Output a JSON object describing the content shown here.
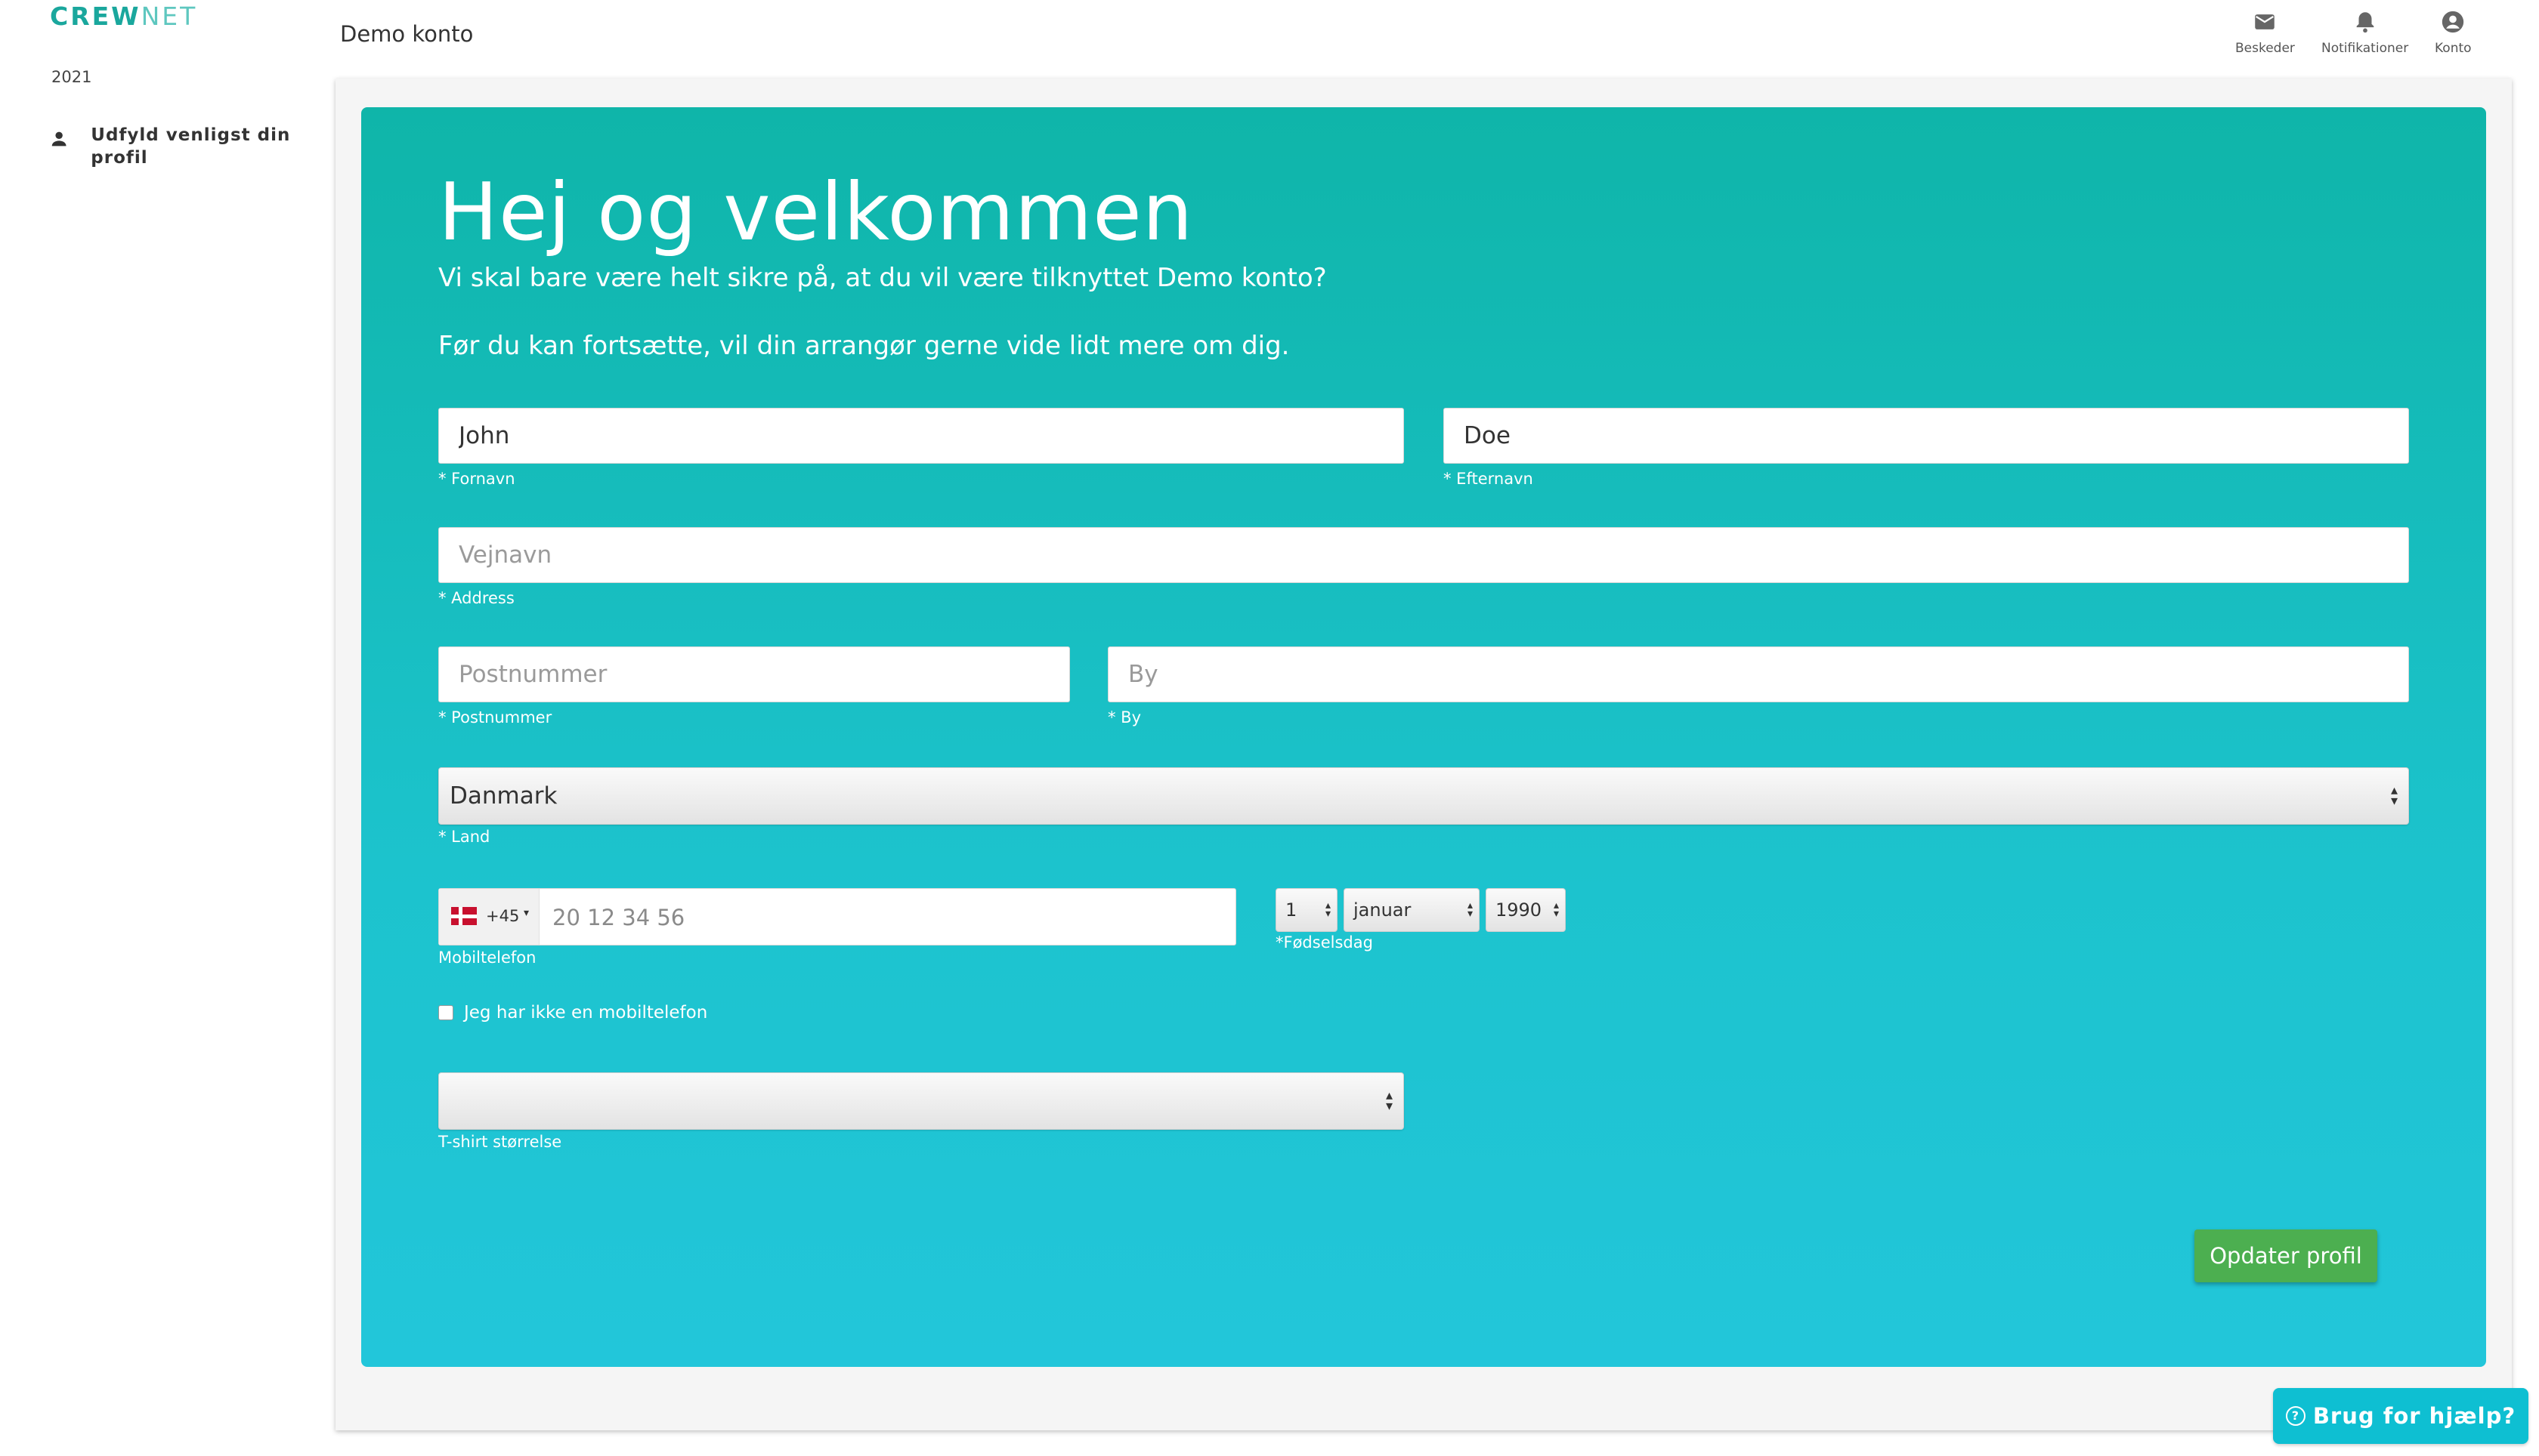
{
  "sidebar": {
    "logo_main": "CREW",
    "logo_light": "NET",
    "year": "2021",
    "items": [
      {
        "label": "Udfyld venligst din profil",
        "icon": "person-icon"
      }
    ]
  },
  "header": {
    "title": "Demo konto",
    "nav": [
      {
        "label": "Beskeder",
        "icon": "mail-icon"
      },
      {
        "label": "Notifikationer",
        "icon": "bell-icon"
      },
      {
        "label": "Konto",
        "icon": "account-icon"
      }
    ]
  },
  "form": {
    "headline": "Hej og velkommen",
    "lead1": "Vi skal bare være helt sikre på, at du vil være tilknyttet Demo konto?",
    "lead2": "Før du kan fortsætte, vil din arrangør gerne vide lidt mere om dig.",
    "first_name": {
      "value": "John",
      "label": "* Fornavn"
    },
    "last_name": {
      "value": "Doe",
      "label": "* Efternavn"
    },
    "address": {
      "placeholder": "Vejnavn",
      "label": "* Address"
    },
    "postal": {
      "placeholder": "Postnummer",
      "label": "* Postnummer"
    },
    "city": {
      "placeholder": "By",
      "label": "* By"
    },
    "country": {
      "value": "Danmark",
      "label": "* Land"
    },
    "phone": {
      "dial_code": "+45",
      "placeholder": "20 12 34 56",
      "label": "Mobiltelefon"
    },
    "birthday": {
      "day": "1",
      "month": "januar",
      "year": "1990",
      "label": "*Fødselsdag"
    },
    "no_phone_label": "Jeg har ikke en mobiltelefon",
    "tshirt": {
      "value": "",
      "label": "T-shirt størrelse"
    },
    "submit_label": "Opdater profil"
  },
  "help_button": {
    "label": "Brug for hjælp?"
  },
  "colors": {
    "brand": "#1aa79d",
    "panel_top": "#0fb5a9",
    "panel_bottom": "#22c6da",
    "submit": "#4caf50",
    "help": "#0ebfd2"
  }
}
